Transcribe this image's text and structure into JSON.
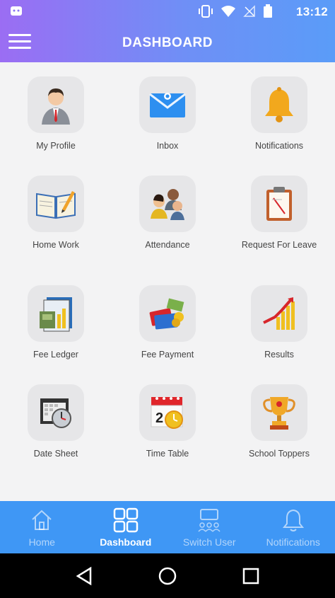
{
  "status_bar": {
    "time": "13:12"
  },
  "app_bar": {
    "title": "DASHBOARD"
  },
  "tiles": [
    {
      "label": "My Profile",
      "icon": "profile-icon"
    },
    {
      "label": "Inbox",
      "icon": "inbox-icon"
    },
    {
      "label": "Notifications",
      "icon": "bell-icon"
    },
    {
      "label": "Home Work",
      "icon": "book-icon"
    },
    {
      "label": "Attendance",
      "icon": "people-icon"
    },
    {
      "label": "Request For Leave",
      "icon": "clipboard-icon"
    },
    {
      "label": "Fee Ledger",
      "icon": "ledger-icon"
    },
    {
      "label": "Fee Payment",
      "icon": "payment-icon"
    },
    {
      "label": "Results",
      "icon": "chart-icon"
    },
    {
      "label": "Date Sheet",
      "icon": "calendar-clock-icon"
    },
    {
      "label": "Time Table",
      "icon": "calendar-icon"
    },
    {
      "label": "School Toppers",
      "icon": "trophy-icon"
    }
  ],
  "bottom_nav": [
    {
      "label": "Home",
      "icon": "home-icon",
      "active": false
    },
    {
      "label": "Dashboard",
      "icon": "grid-icon",
      "active": true
    },
    {
      "label": "Switch User",
      "icon": "switch-user-icon",
      "active": false
    },
    {
      "label": "Notifications",
      "icon": "bell-outline-icon",
      "active": false
    }
  ],
  "colors": {
    "header_gradient_start": "#9b6df3",
    "header_gradient_end": "#5a9cf8",
    "bottom_nav_bg": "#3f97f5",
    "tile_bg": "#e6e6e8"
  }
}
